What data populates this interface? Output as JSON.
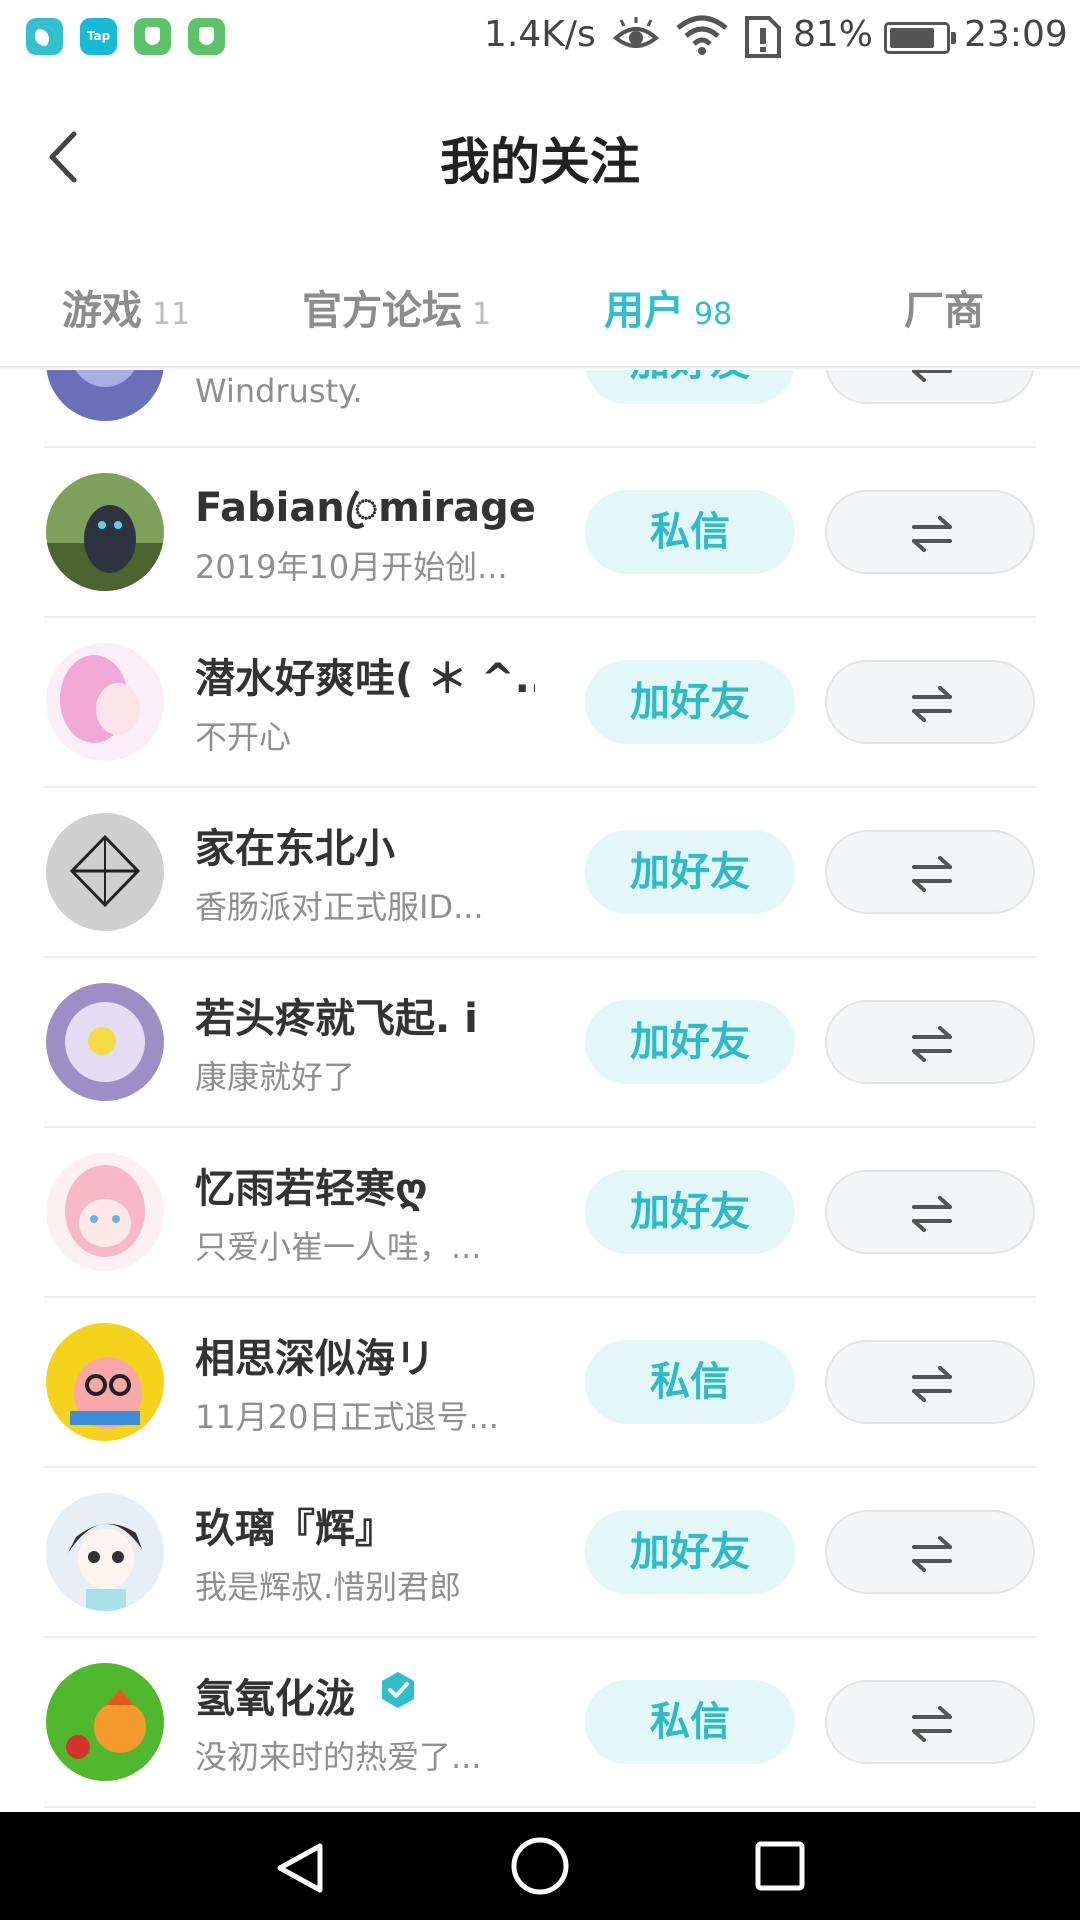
{
  "status_bar": {
    "app_icons": [
      "moon-app-icon",
      "taptap-app-icon",
      "shield-app-icon",
      "shield-app-icon"
    ],
    "tap_label": "Tap",
    "net_speed": "1.4K/s",
    "battery_percent": "81%",
    "battery_level": 0.81,
    "time": "23:09"
  },
  "header": {
    "title": "我的关注",
    "back_icon": "chevron-left-icon"
  },
  "tabs": [
    {
      "label": "游戏",
      "count": "11",
      "active": false
    },
    {
      "label": "官方论坛",
      "count": "1",
      "active": false
    },
    {
      "label": "用户",
      "count": "98",
      "active": true
    },
    {
      "label": "厂商",
      "count": "",
      "active": false
    }
  ],
  "accent_color": "#2fbecb",
  "users": [
    {
      "name": "",
      "bio": "Windrusty.",
      "action": "加好友",
      "verified": false,
      "avatar_color": "#6b6fb8"
    },
    {
      "name": "Fabianꦿmirage",
      "bio": "2019年10月开始创...",
      "action": "私信",
      "verified": false,
      "avatar_color": "#5a7a3a"
    },
    {
      "name": "潜水好爽哇( ＊ ^...",
      "bio": "不开心",
      "action": "加好友",
      "verified": false,
      "avatar_color": "#f2c6e0"
    },
    {
      "name": "家在东北小",
      "bio": "香肠派对正式服ID...",
      "action": "加好友",
      "verified": false,
      "avatar_color": "#c8c8c8"
    },
    {
      "name": "若头疼就飞起. i",
      "bio": "康康就好了",
      "action": "加好友",
      "verified": false,
      "avatar_color": "#b8aad8"
    },
    {
      "name": "忆雨若轻寒ღ",
      "bio": "只爱小崔一人哇，...",
      "action": "加好友",
      "verified": false,
      "avatar_color": "#fbe0e6"
    },
    {
      "name": "相思深似海リ",
      "bio": "11月20日正式退号...",
      "action": "私信",
      "verified": false,
      "avatar_color": "#f5d21c"
    },
    {
      "name": "玖璃『辉』",
      "bio": "我是辉叔.惜别君郎",
      "action": "加好友",
      "verified": false,
      "avatar_color": "#e6eef6"
    },
    {
      "name": "氢氧化泷",
      "bio": "没初来时的热爱了...",
      "action": "私信",
      "verified": true,
      "avatar_color": "#4fb82c"
    }
  ],
  "more_button_icon": "swap-arrows-icon",
  "nav_bar": {
    "back_icon": "triangle-back-icon",
    "home_icon": "circle-home-icon",
    "recent_icon": "square-recent-icon"
  }
}
